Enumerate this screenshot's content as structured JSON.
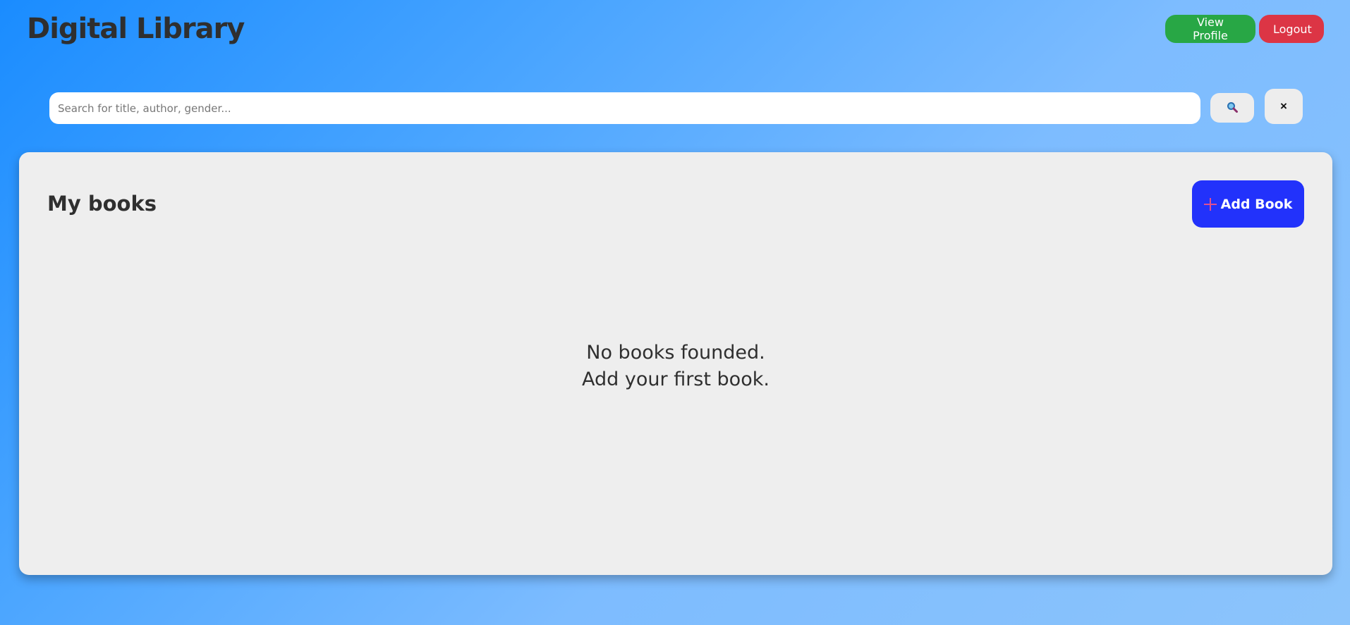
{
  "header": {
    "title": "Digital Library",
    "view_profile_label": "View Profile",
    "logout_label": "Logout"
  },
  "search": {
    "placeholder": "Search for title, author, gender...",
    "value": "",
    "clear_label": "×"
  },
  "books": {
    "title": "My books",
    "add_button_label": "Add Book",
    "empty_line_1": "No books founded.",
    "empty_line_2": "Add your first book."
  },
  "icons": {
    "search": "search-icon",
    "close": "close-icon",
    "add": "plus-icon"
  },
  "colors": {
    "view_profile": "#28a745",
    "logout": "#dc3545",
    "add_book": "#2232fb",
    "panel": "#eeeeee"
  }
}
